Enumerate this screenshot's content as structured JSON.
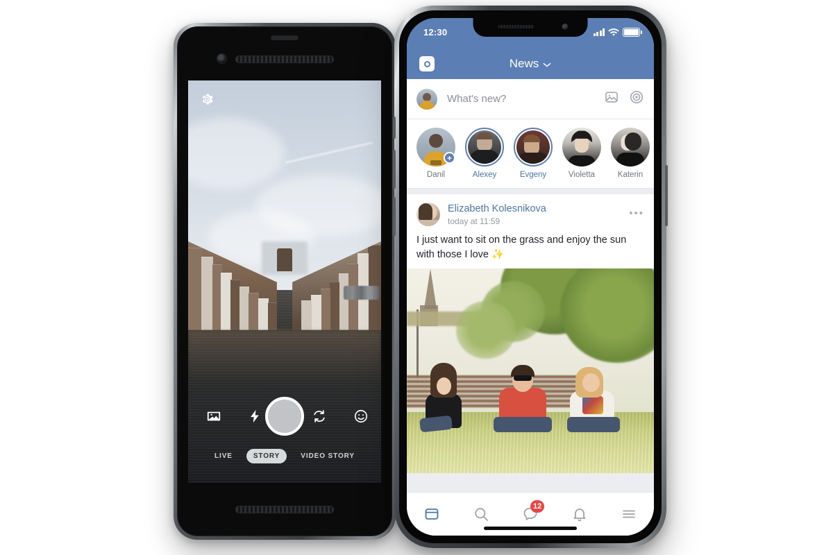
{
  "scene": {
    "background_color": "#ffffff",
    "description": "Two smartphones side by side showing a camera story capture screen and a social network news feed"
  },
  "left_phone": {
    "device_name": "android-phone",
    "camera": {
      "gear_icon": "settings-gear-icon",
      "shutter_label": "shutter-button",
      "controls": [
        {
          "name": "gallery-icon",
          "label": "Gallery"
        },
        {
          "name": "flash-icon",
          "label": "Flash"
        },
        {
          "name": "flip-camera-icon",
          "label": "Flip camera"
        },
        {
          "name": "mask-effects-icon",
          "label": "Masks"
        }
      ],
      "modes": [
        {
          "label": "LIVE",
          "active": false
        },
        {
          "label": "STORY",
          "active": true
        },
        {
          "label": "VIDEO STORY",
          "active": false
        }
      ],
      "scene_subject": "Bruges canal with historic brick houses and a stone bridge"
    }
  },
  "right_phone": {
    "device_name": "iphone-x",
    "status_bar": {
      "time": "12:30",
      "signal_icon": "cellular-signal-icon",
      "wifi_icon": "wifi-icon",
      "battery_icon": "battery-full-icon"
    },
    "nav_bar": {
      "logo_icon": "vk-logo-icon",
      "title": "News",
      "chevron": "⌄",
      "background_color": "#5B7FB5"
    },
    "composer": {
      "placeholder": "What's new?",
      "avatar": "user-avatar",
      "icons": [
        {
          "name": "photo-icon",
          "label": "Add photo"
        },
        {
          "name": "camera-target-icon",
          "label": "Camera"
        }
      ]
    },
    "stories": [
      {
        "name": "Danil",
        "unread": false,
        "add_badge": "+"
      },
      {
        "name": "Alexey",
        "unread": true,
        "add_badge": ""
      },
      {
        "name": "Evgeny",
        "unread": true,
        "add_badge": ""
      },
      {
        "name": "Violetta",
        "unread": false,
        "add_badge": ""
      },
      {
        "name": "Katerin",
        "unread": false,
        "add_badge": ""
      }
    ],
    "post": {
      "author": "Elizabeth Kolesnikova",
      "timestamp": "today at 11:59",
      "more_icon": "•••",
      "text": "I just want to sit on the grass and enjoy the sun with those I love ✨",
      "photo_alt": "Three friends sitting on grass in a park laughing"
    },
    "tab_bar": [
      {
        "name": "feed-tab",
        "icon": "feed-icon",
        "active": true,
        "badge": ""
      },
      {
        "name": "search-tab",
        "icon": "search-icon",
        "active": false,
        "badge": ""
      },
      {
        "name": "messages-tab",
        "icon": "message-bubble-icon",
        "active": false,
        "badge": "12"
      },
      {
        "name": "notifications-tab",
        "icon": "bell-icon",
        "active": false,
        "badge": ""
      },
      {
        "name": "menu-tab",
        "icon": "hamburger-menu-icon",
        "active": false,
        "badge": ""
      }
    ],
    "colors": {
      "accent": "#5B7FB5",
      "link": "#4a76a8",
      "badge": "#e64646",
      "feed_bg": "#ebedf0"
    }
  }
}
